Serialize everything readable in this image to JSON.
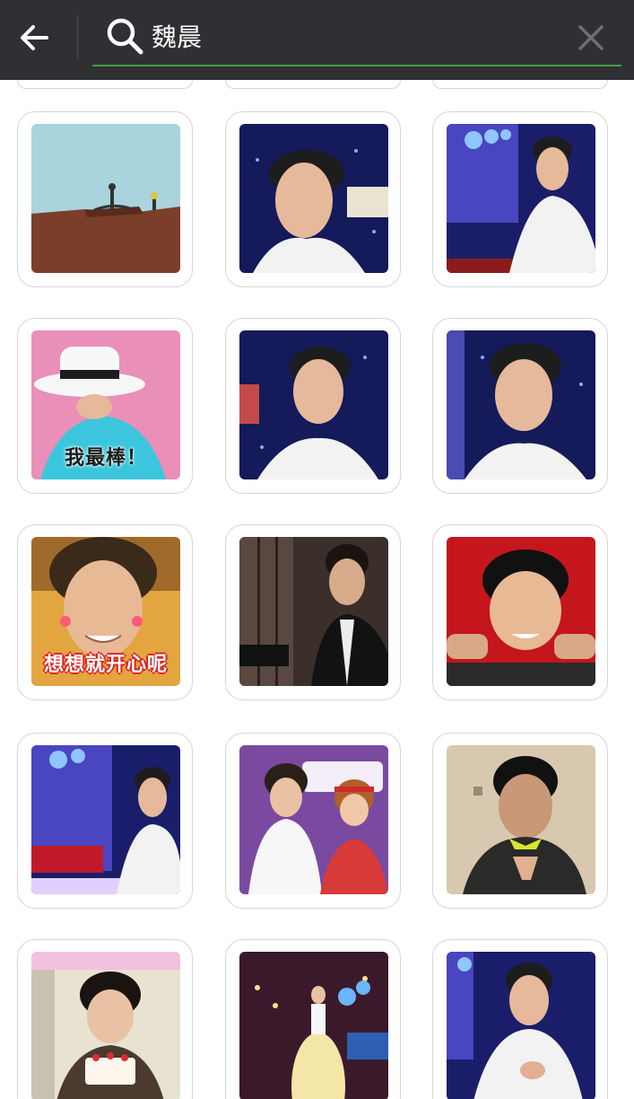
{
  "search": {
    "query": "魏晨"
  },
  "stickers": [
    {
      "caption": ""
    },
    {
      "caption": ""
    },
    {
      "caption": ""
    },
    {
      "caption": "我最棒！"
    },
    {
      "caption": ""
    },
    {
      "caption": ""
    },
    {
      "caption": "想想就开心呢"
    },
    {
      "caption": ""
    },
    {
      "caption": ""
    },
    {
      "caption": ""
    },
    {
      "caption": ""
    },
    {
      "caption": ""
    },
    {
      "caption": ""
    },
    {
      "caption": ""
    },
    {
      "caption": ""
    }
  ],
  "colors": {
    "topbar": "#2f3033",
    "accent": "#43a047"
  }
}
